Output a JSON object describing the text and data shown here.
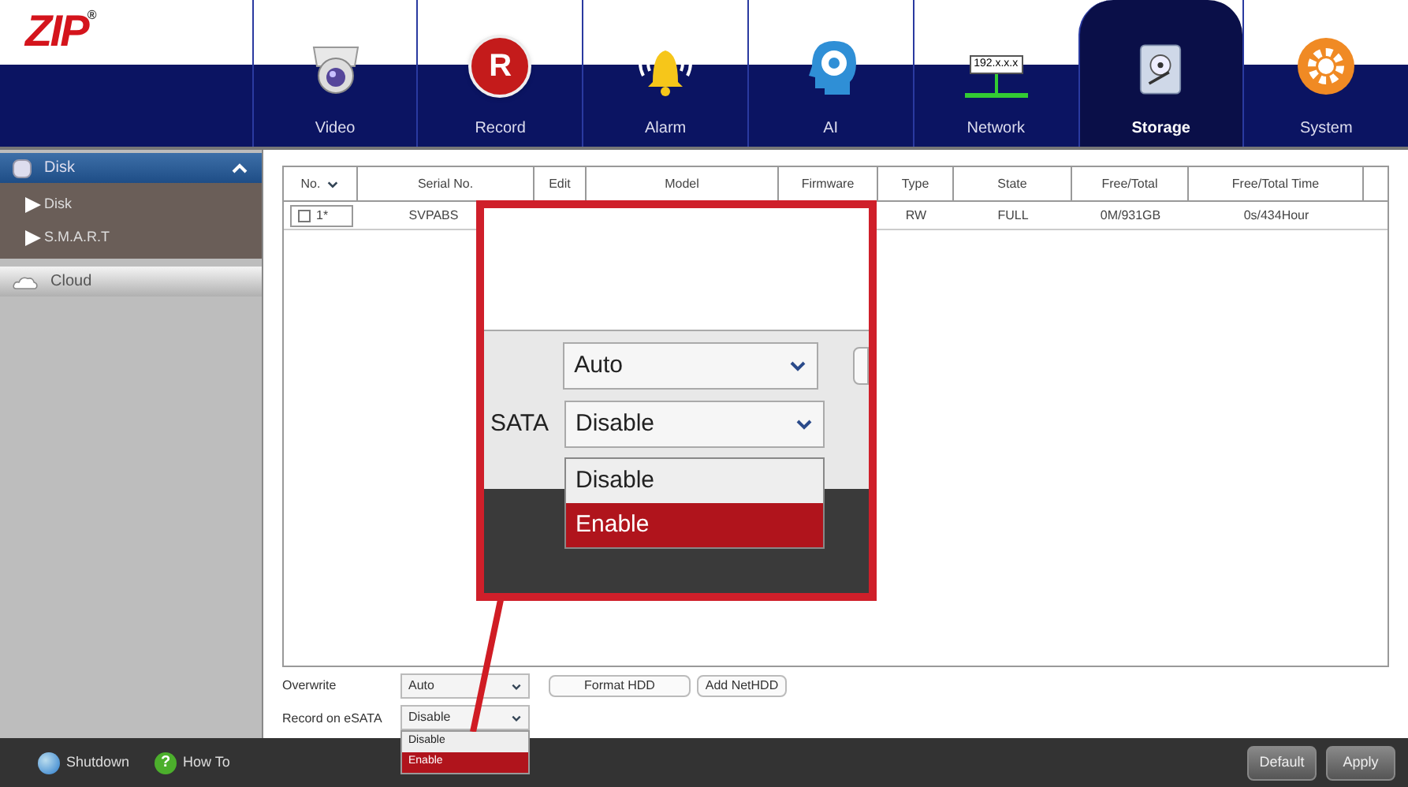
{
  "logo": {
    "text": "ZIP",
    "mark": "®"
  },
  "nav": [
    {
      "label": "Video",
      "kind": "camera",
      "selected": false
    },
    {
      "label": "Record",
      "kind": "record",
      "icon_text": "R",
      "selected": false
    },
    {
      "label": "Alarm",
      "kind": "bell",
      "selected": false
    },
    {
      "label": "AI",
      "kind": "ai",
      "selected": false
    },
    {
      "label": "Network",
      "kind": "network",
      "icon_text": "192.x.x.x",
      "selected": false
    },
    {
      "label": "Storage",
      "kind": "disk",
      "selected": true
    },
    {
      "label": "System",
      "kind": "gear",
      "selected": false
    }
  ],
  "sidebar": [
    {
      "label": "Disk",
      "kind": "disk",
      "expanded": true,
      "children": [
        {
          "label": "Disk"
        },
        {
          "label": "S.M.A.R.T"
        }
      ]
    },
    {
      "label": "Cloud",
      "kind": "cloud",
      "expanded": false
    }
  ],
  "table": {
    "columns": [
      {
        "label": "No.",
        "sortable": true
      },
      {
        "label": "Serial No.",
        "sortable": false
      },
      {
        "label": "Edit",
        "sortable": false
      },
      {
        "label": "Model",
        "sortable": false
      },
      {
        "label": "Firmware",
        "sortable": false
      },
      {
        "label": "Type",
        "sortable": false
      },
      {
        "label": "State",
        "sortable": false
      },
      {
        "label": "Free/Total",
        "sortable": false
      },
      {
        "label": "Free/Total Time",
        "sortable": false
      }
    ],
    "rows": [
      {
        "checked": false,
        "no": "1*",
        "serial": "SVPABS",
        "type": "RW",
        "state": "FULL",
        "free_total": "0M/931GB",
        "free_total_time": "0s/434Hour"
      }
    ]
  },
  "callout": {
    "fields": [
      {
        "value": "Auto"
      },
      {
        "label": "SATA",
        "value": "Disable"
      }
    ],
    "options": [
      {
        "label": "Disable",
        "highlighted": false
      },
      {
        "label": "Enable",
        "highlighted": true
      }
    ]
  },
  "settings": {
    "overwrite": {
      "label": "Overwrite",
      "value": "Auto"
    },
    "buttons": [
      "Format HDD",
      "Add NetHDD"
    ],
    "esata": {
      "label": "Record on eSATA",
      "value": "Disable",
      "open": true,
      "options": [
        {
          "label": "Disable",
          "highlighted": false
        },
        {
          "label": "Enable",
          "highlighted": true
        }
      ]
    }
  },
  "footer": {
    "links": [
      {
        "label": "Shutdown",
        "kind": "power"
      },
      {
        "label": "How To",
        "kind": "help",
        "icon_text": "?"
      }
    ],
    "buttons": [
      "Default",
      "Apply"
    ]
  }
}
